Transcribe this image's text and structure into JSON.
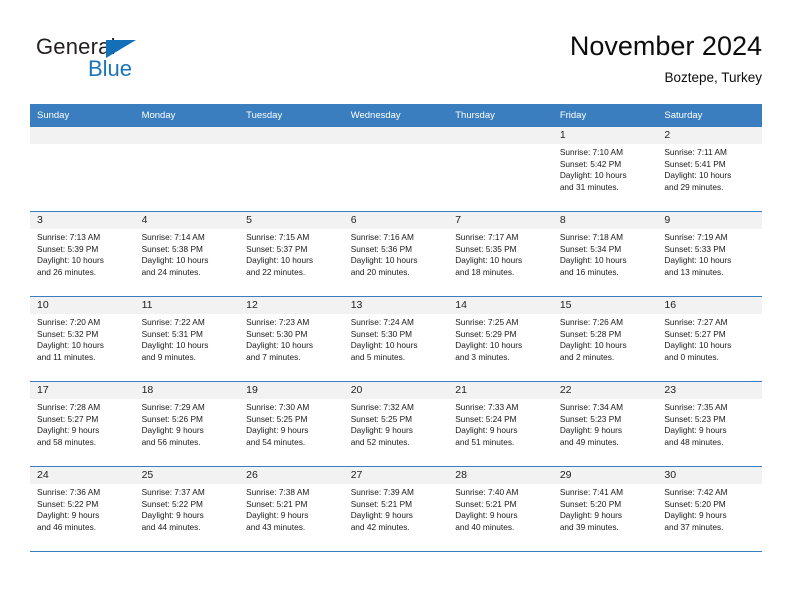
{
  "brand": {
    "name_top": "General",
    "name_bottom": "Blue",
    "accent_color": "#1b75bb",
    "triangle_color": "#136fb7"
  },
  "header": {
    "title": "November 2024",
    "subtitle": "Boztepe, Turkey"
  },
  "calendar": {
    "header_bg": "#3a7ebf",
    "daynum_strip_bg": "#f2f2f2",
    "weekday_headers": [
      "Sunday",
      "Monday",
      "Tuesday",
      "Wednesday",
      "Thursday",
      "Friday",
      "Saturday"
    ],
    "weeks": [
      [
        {
          "day": "",
          "sunrise": "",
          "sunset": "",
          "daylight_line1": "",
          "daylight_line2": "",
          "empty": true
        },
        {
          "day": "",
          "sunrise": "",
          "sunset": "",
          "daylight_line1": "",
          "daylight_line2": "",
          "empty": true
        },
        {
          "day": "",
          "sunrise": "",
          "sunset": "",
          "daylight_line1": "",
          "daylight_line2": "",
          "empty": true
        },
        {
          "day": "",
          "sunrise": "",
          "sunset": "",
          "daylight_line1": "",
          "daylight_line2": "",
          "empty": true
        },
        {
          "day": "",
          "sunrise": "",
          "sunset": "",
          "daylight_line1": "",
          "daylight_line2": "",
          "empty": true
        },
        {
          "day": "1",
          "sunrise": "Sunrise: 7:10 AM",
          "sunset": "Sunset: 5:42 PM",
          "daylight_line1": "Daylight: 10 hours",
          "daylight_line2": "and 31 minutes.",
          "empty": false
        },
        {
          "day": "2",
          "sunrise": "Sunrise: 7:11 AM",
          "sunset": "Sunset: 5:41 PM",
          "daylight_line1": "Daylight: 10 hours",
          "daylight_line2": "and 29 minutes.",
          "empty": false
        }
      ],
      [
        {
          "day": "3",
          "sunrise": "Sunrise: 7:13 AM",
          "sunset": "Sunset: 5:39 PM",
          "daylight_line1": "Daylight: 10 hours",
          "daylight_line2": "and 26 minutes.",
          "empty": false
        },
        {
          "day": "4",
          "sunrise": "Sunrise: 7:14 AM",
          "sunset": "Sunset: 5:38 PM",
          "daylight_line1": "Daylight: 10 hours",
          "daylight_line2": "and 24 minutes.",
          "empty": false
        },
        {
          "day": "5",
          "sunrise": "Sunrise: 7:15 AM",
          "sunset": "Sunset: 5:37 PM",
          "daylight_line1": "Daylight: 10 hours",
          "daylight_line2": "and 22 minutes.",
          "empty": false
        },
        {
          "day": "6",
          "sunrise": "Sunrise: 7:16 AM",
          "sunset": "Sunset: 5:36 PM",
          "daylight_line1": "Daylight: 10 hours",
          "daylight_line2": "and 20 minutes.",
          "empty": false
        },
        {
          "day": "7",
          "sunrise": "Sunrise: 7:17 AM",
          "sunset": "Sunset: 5:35 PM",
          "daylight_line1": "Daylight: 10 hours",
          "daylight_line2": "and 18 minutes.",
          "empty": false
        },
        {
          "day": "8",
          "sunrise": "Sunrise: 7:18 AM",
          "sunset": "Sunset: 5:34 PM",
          "daylight_line1": "Daylight: 10 hours",
          "daylight_line2": "and 16 minutes.",
          "empty": false
        },
        {
          "day": "9",
          "sunrise": "Sunrise: 7:19 AM",
          "sunset": "Sunset: 5:33 PM",
          "daylight_line1": "Daylight: 10 hours",
          "daylight_line2": "and 13 minutes.",
          "empty": false
        }
      ],
      [
        {
          "day": "10",
          "sunrise": "Sunrise: 7:20 AM",
          "sunset": "Sunset: 5:32 PM",
          "daylight_line1": "Daylight: 10 hours",
          "daylight_line2": "and 11 minutes.",
          "empty": false
        },
        {
          "day": "11",
          "sunrise": "Sunrise: 7:22 AM",
          "sunset": "Sunset: 5:31 PM",
          "daylight_line1": "Daylight: 10 hours",
          "daylight_line2": "and 9 minutes.",
          "empty": false
        },
        {
          "day": "12",
          "sunrise": "Sunrise: 7:23 AM",
          "sunset": "Sunset: 5:30 PM",
          "daylight_line1": "Daylight: 10 hours",
          "daylight_line2": "and 7 minutes.",
          "empty": false
        },
        {
          "day": "13",
          "sunrise": "Sunrise: 7:24 AM",
          "sunset": "Sunset: 5:30 PM",
          "daylight_line1": "Daylight: 10 hours",
          "daylight_line2": "and 5 minutes.",
          "empty": false
        },
        {
          "day": "14",
          "sunrise": "Sunrise: 7:25 AM",
          "sunset": "Sunset: 5:29 PM",
          "daylight_line1": "Daylight: 10 hours",
          "daylight_line2": "and 3 minutes.",
          "empty": false
        },
        {
          "day": "15",
          "sunrise": "Sunrise: 7:26 AM",
          "sunset": "Sunset: 5:28 PM",
          "daylight_line1": "Daylight: 10 hours",
          "daylight_line2": "and 2 minutes.",
          "empty": false
        },
        {
          "day": "16",
          "sunrise": "Sunrise: 7:27 AM",
          "sunset": "Sunset: 5:27 PM",
          "daylight_line1": "Daylight: 10 hours",
          "daylight_line2": "and 0 minutes.",
          "empty": false
        }
      ],
      [
        {
          "day": "17",
          "sunrise": "Sunrise: 7:28 AM",
          "sunset": "Sunset: 5:27 PM",
          "daylight_line1": "Daylight: 9 hours",
          "daylight_line2": "and 58 minutes.",
          "empty": false
        },
        {
          "day": "18",
          "sunrise": "Sunrise: 7:29 AM",
          "sunset": "Sunset: 5:26 PM",
          "daylight_line1": "Daylight: 9 hours",
          "daylight_line2": "and 56 minutes.",
          "empty": false
        },
        {
          "day": "19",
          "sunrise": "Sunrise: 7:30 AM",
          "sunset": "Sunset: 5:25 PM",
          "daylight_line1": "Daylight: 9 hours",
          "daylight_line2": "and 54 minutes.",
          "empty": false
        },
        {
          "day": "20",
          "sunrise": "Sunrise: 7:32 AM",
          "sunset": "Sunset: 5:25 PM",
          "daylight_line1": "Daylight: 9 hours",
          "daylight_line2": "and 52 minutes.",
          "empty": false
        },
        {
          "day": "21",
          "sunrise": "Sunrise: 7:33 AM",
          "sunset": "Sunset: 5:24 PM",
          "daylight_line1": "Daylight: 9 hours",
          "daylight_line2": "and 51 minutes.",
          "empty": false
        },
        {
          "day": "22",
          "sunrise": "Sunrise: 7:34 AM",
          "sunset": "Sunset: 5:23 PM",
          "daylight_line1": "Daylight: 9 hours",
          "daylight_line2": "and 49 minutes.",
          "empty": false
        },
        {
          "day": "23",
          "sunrise": "Sunrise: 7:35 AM",
          "sunset": "Sunset: 5:23 PM",
          "daylight_line1": "Daylight: 9 hours",
          "daylight_line2": "and 48 minutes.",
          "empty": false
        }
      ],
      [
        {
          "day": "24",
          "sunrise": "Sunrise: 7:36 AM",
          "sunset": "Sunset: 5:22 PM",
          "daylight_line1": "Daylight: 9 hours",
          "daylight_line2": "and 46 minutes.",
          "empty": false
        },
        {
          "day": "25",
          "sunrise": "Sunrise: 7:37 AM",
          "sunset": "Sunset: 5:22 PM",
          "daylight_line1": "Daylight: 9 hours",
          "daylight_line2": "and 44 minutes.",
          "empty": false
        },
        {
          "day": "26",
          "sunrise": "Sunrise: 7:38 AM",
          "sunset": "Sunset: 5:21 PM",
          "daylight_line1": "Daylight: 9 hours",
          "daylight_line2": "and 43 minutes.",
          "empty": false
        },
        {
          "day": "27",
          "sunrise": "Sunrise: 7:39 AM",
          "sunset": "Sunset: 5:21 PM",
          "daylight_line1": "Daylight: 9 hours",
          "daylight_line2": "and 42 minutes.",
          "empty": false
        },
        {
          "day": "28",
          "sunrise": "Sunrise: 7:40 AM",
          "sunset": "Sunset: 5:21 PM",
          "daylight_line1": "Daylight: 9 hours",
          "daylight_line2": "and 40 minutes.",
          "empty": false
        },
        {
          "day": "29",
          "sunrise": "Sunrise: 7:41 AM",
          "sunset": "Sunset: 5:20 PM",
          "daylight_line1": "Daylight: 9 hours",
          "daylight_line2": "and 39 minutes.",
          "empty": false
        },
        {
          "day": "30",
          "sunrise": "Sunrise: 7:42 AM",
          "sunset": "Sunset: 5:20 PM",
          "daylight_line1": "Daylight: 9 hours",
          "daylight_line2": "and 37 minutes.",
          "empty": false
        }
      ]
    ]
  }
}
